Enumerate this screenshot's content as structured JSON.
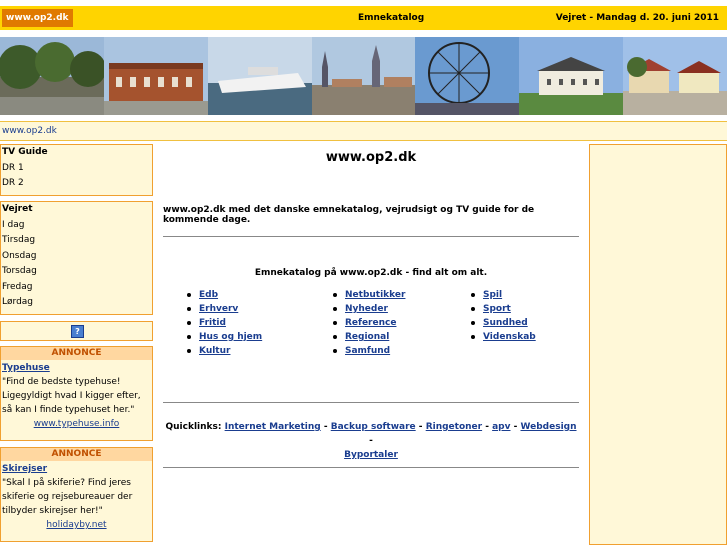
{
  "header": {
    "logo": "www.op2.dk",
    "center": "Emnekatalog",
    "right": "Vejret - Mandag d. 20. juni 2011"
  },
  "photos": [
    "trees-street",
    "brick-building",
    "ferry",
    "city-towers",
    "ferris-wheel",
    "manor-house",
    "village-square"
  ],
  "urlbar": "www.op2.dk",
  "sidebar": {
    "tv": {
      "head": "TV Guide",
      "items": [
        "DR 1",
        "DR 2"
      ]
    },
    "weather": {
      "head": "Vejret",
      "items": [
        "I dag",
        "Tirsdag",
        "Onsdag",
        "Torsdag",
        "Fredag",
        "Lørdag"
      ]
    },
    "help_icon": "?",
    "ads": [
      {
        "head": "ANNONCE",
        "title": "Typehuse",
        "text": "\"Find de bedste typehuse! Ligegyldigt hvad I kigger efter, så kan I finde typehuset her.\"",
        "link": "www.typehuse.info"
      },
      {
        "head": "ANNONCE",
        "title": "Skirejser",
        "text": "\"Skal I på skiferie? Find jeres skiferie og rejsebureauer der tilbyder skirejser her!\"",
        "link": "holidayby.net"
      }
    ]
  },
  "main": {
    "title": "www.op2.dk",
    "intro": "www.op2.dk med det danske emnekatalog, vejrudsigt og TV guide for de kommende dage.",
    "catalog_head": "Emnekatalog på www.op2.dk - find alt om alt.",
    "col1": [
      "Edb",
      "Erhverv",
      "Fritid",
      "Hus og hjem",
      "Kultur"
    ],
    "col2": [
      "Netbutikker",
      "Nyheder",
      "Reference",
      "Regional",
      "Samfund"
    ],
    "col3": [
      "Spil",
      "Sport",
      "Sundhed",
      "Videnskab"
    ],
    "quicklinks_label": "Quicklinks:",
    "quicklinks": [
      "Internet Marketing",
      "Backup software",
      "Ringetoner",
      "apv",
      "Webdesign",
      "Byportaler"
    ]
  }
}
